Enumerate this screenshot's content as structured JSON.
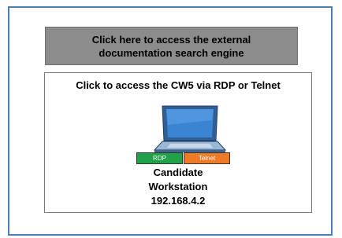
{
  "docs_button": {
    "line1": "Click here to access the external",
    "line2": "documentation search engine"
  },
  "cw5_panel": {
    "title": "Click to access the CW5 via RDP or Telnet",
    "rdp_label": "RDP",
    "telnet_label": "Telnet",
    "workstation_line1": "Candidate",
    "workstation_line2": "Workstation",
    "ip_address": "192.168.4.2",
    "icon": "laptop-icon"
  },
  "colors": {
    "frame_border": "#4a7fb5",
    "docs_button_bg": "#8c8c8c",
    "rdp": "#21a14a",
    "telnet": "#ee7a26",
    "laptop_screen": "#3b84d1"
  }
}
